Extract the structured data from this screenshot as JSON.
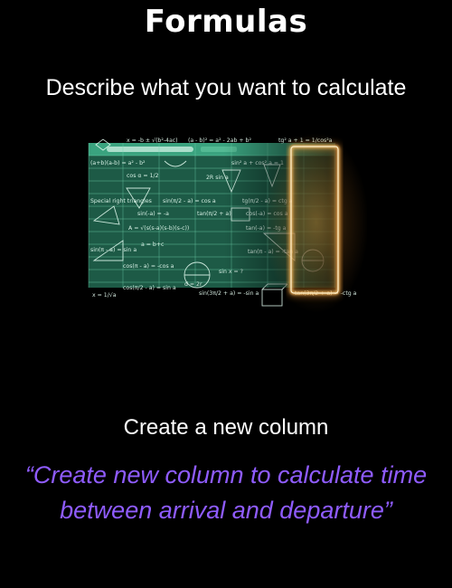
{
  "page": {
    "title": "Formulas",
    "subtitle": "Describe what you want to calculate",
    "caption": "Create a new column",
    "prompt": "“Create new column to calculate time between arrival and departure”"
  },
  "hero": {
    "image": "spreadsheet-of-math-formulas-with-glowing-highlighted-column",
    "formulas": [
      "(a - b)² = a² - 2ab + b²",
      "tg² a + 1 = 1/cos² a",
      "(a+b)(a-b) = a² - b²",
      "sin² a + cos² a = 1",
      "cos α = 1/2",
      "sin(π/2 - a) = cos a",
      "tan α = sin α / cos α",
      "Special Right Triangles",
      "sin(-a) = -a",
      "tan(π/2 + a)",
      "cos(-a) = cos a",
      "A = √(s(s-a)(s-b)(s-c))",
      "tan(-a) = -tg a",
      "sin(π - a) = sin a",
      "tan(π - a) = -tan a",
      "cos(π - a) = -cos a",
      "sin x = ?",
      "cos(π/2 - a) = sin a",
      "sin(3π/2 + a) = -sin a",
      "tan(3π/2 + a) = -ctg a"
    ]
  },
  "colors": {
    "background": "#000000",
    "text": "#ffffff",
    "accent_purple": "#8f5cff",
    "sheet_green": "#1d5a46",
    "sheet_header": "#3aa37f",
    "glow": "#ffb347"
  }
}
